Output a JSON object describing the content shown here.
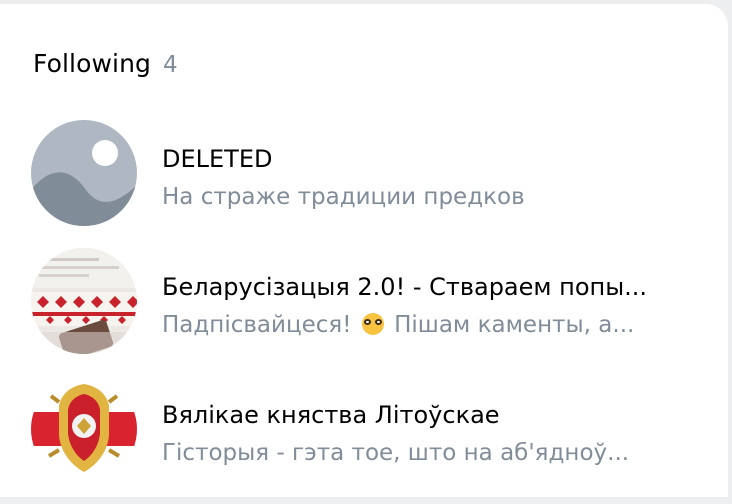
{
  "following": {
    "title": "Following",
    "count": "4",
    "items": [
      {
        "name": "DELETED",
        "subtitle": "На страже традиции предков",
        "avatar": "deleted-placeholder"
      },
      {
        "name": "Беларусізацыя 2.0! - Ствараем попы...",
        "subtitle_before": "Падпісвайцеся!",
        "subtitle_emoji": "nerd-face-emoji",
        "subtitle_after": "Пішам каменты, а...",
        "avatar": "photo-embroidery"
      },
      {
        "name": "Вялікае княства Літоўскае",
        "subtitle": "Гісторыя - гэта тое, што на аб'ядноў...",
        "avatar": "coat-of-arms"
      }
    ]
  }
}
